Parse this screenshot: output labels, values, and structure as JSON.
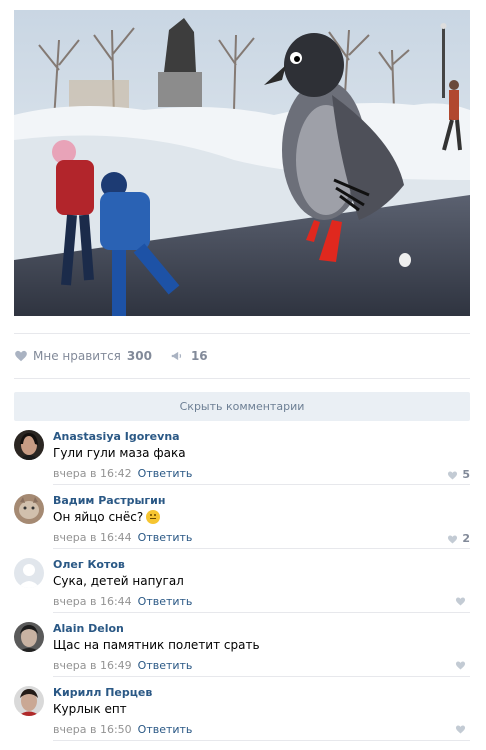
{
  "post": {
    "likes_label": "Мне нравится",
    "likes_count": "300",
    "reposts_count": "16",
    "hide_comments_label": "Скрыть комментарии"
  },
  "comments": [
    {
      "author": "Anastasiya Igorevna",
      "text": "Гули гули маза фака",
      "time": "вчера в 16:42",
      "reply": "Ответить",
      "likes": "5"
    },
    {
      "author": "Вадим Растрыгин",
      "text": "Он яйцо снёс?",
      "time": "вчера в 16:44",
      "reply": "Ответить",
      "likes": "2"
    },
    {
      "author": "Олег Котов",
      "text": "Сука, детей напугал",
      "time": "вчера в 16:44",
      "reply": "Ответить",
      "likes": ""
    },
    {
      "author": "Alain Delon",
      "text": "Щас на памятник полетит срать",
      "time": "вчера в 16:49",
      "reply": "Ответить",
      "likes": ""
    },
    {
      "author": "Кирилл Перцев",
      "text": "Курлык епт",
      "time": "вчера в 16:50",
      "reply": "Ответить",
      "likes": ""
    }
  ],
  "icons": {
    "like": "heart-icon",
    "repost": "megaphone-icon",
    "accent": "#2a5885",
    "muted": "#828a99"
  }
}
